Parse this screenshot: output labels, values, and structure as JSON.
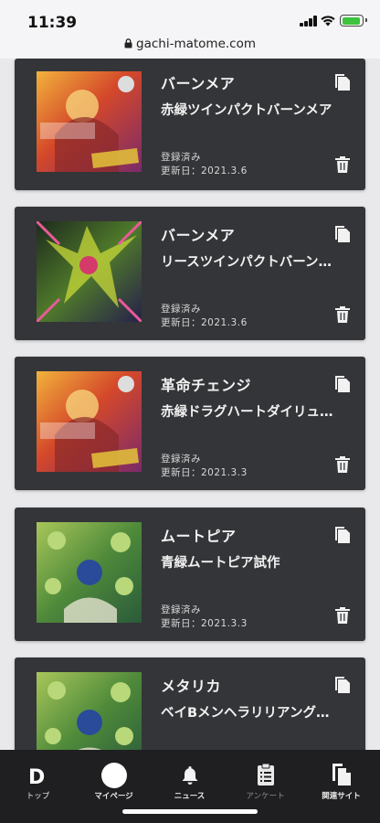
{
  "status_bar": {
    "time": "11:39",
    "url": "gachi-matome.com",
    "battery_color": "#3cc43c"
  },
  "cards": [
    {
      "title": "バーンメア",
      "subtitle": "赤緑ツインパクトバーンメア",
      "status": "登録済み",
      "date": "更新日：2021.3.6",
      "image": "duel-masters-card-art-red"
    },
    {
      "title": "バーンメア",
      "subtitle": "リースツインパクトバーン…",
      "status": "登録済み",
      "date": "更新日：2021.3.6",
      "image": "duel-masters-card-art-dragon"
    },
    {
      "title": "革命チェンジ",
      "subtitle": "赤緑ドラグハートダイリュ…",
      "status": "登録済み",
      "date": "更新日：2021.3.3",
      "image": "duel-masters-card-art-red"
    },
    {
      "title": "ムートピア",
      "subtitle": "青緑ムートピア試作",
      "status": "登録済み",
      "date": "更新日：2021.3.3",
      "image": "duel-masters-card-art-green"
    },
    {
      "title": "メタリカ",
      "subtitle": "ベイBメンヘラリリアング試作",
      "status": "",
      "date": "",
      "image": "duel-masters-card-art-green"
    }
  ],
  "bottom_nav": {
    "logo_text": "D",
    "items": [
      {
        "label": "トップ",
        "icon": "logo-icon"
      },
      {
        "label": "マイページ",
        "icon": "profile-circle-icon"
      },
      {
        "label": "ニュース",
        "icon": "bell-icon"
      },
      {
        "label": "アンケート",
        "icon": "clipboard-icon"
      },
      {
        "label": "関連サイト",
        "icon": "copy-docs-icon"
      }
    ]
  },
  "colors": {
    "card_background": "#343538",
    "page_background": "#e9e9eb",
    "nav_background": "#1f1f21"
  }
}
